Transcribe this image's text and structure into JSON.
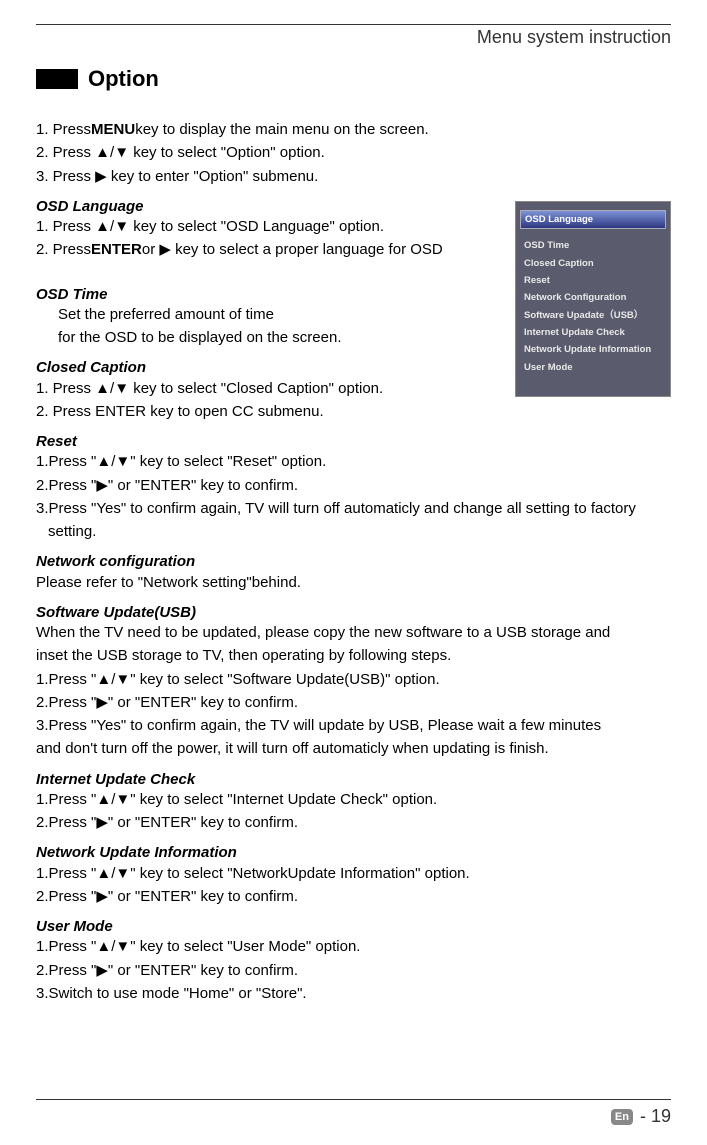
{
  "header_section": "Menu system instruction",
  "title": "Option",
  "intro": {
    "l1_a": "1. Press ",
    "l1_b": "MENU",
    "l1_c": " key to display the main menu on the screen.",
    "l2": "2. Press ▲/▼ key to select \"Option\" option.",
    "l3": "3. Press ▶ key to enter \"Option\" submenu."
  },
  "osd_language": {
    "h": "OSD Language",
    "l1": "1. Press ▲/▼ key to select \"OSD Language\" option.",
    "l2_a": "2. Press ",
    "l2_b": "ENTER",
    "l2_c": " or ▶ key to select a proper language for OSD"
  },
  "osd_time": {
    "h": "OSD Time",
    "l1": "Set the preferred amount of time",
    "l2": "for the OSD to be displayed on the screen."
  },
  "closed_caption": {
    "h": "Closed Caption",
    "l1": "1. Press ▲/▼ key to select \"Closed Caption\" option.",
    "l2": "2. Press  ENTER  key  to  open  CC  submenu."
  },
  "reset": {
    "h": "Reset",
    "l1": "1.Press \"▲/▼\" key to select \"Reset\" option.",
    "l2": "2.Press \"▶\" or \"ENTER\" key to confirm.",
    "l3": "3.Press \"Yes\" to confirm again, TV will turn off automaticly and change all setting to factory",
    "l3b": "setting."
  },
  "network_config": {
    "h": "Network configuration",
    "l1": "Please refer to \"Network setting\"behind."
  },
  "software_update": {
    "h": "Software Update(USB)",
    "l1": "When the TV need to be updated, please copy the new software to a USB storage and",
    "l2": "inset the USB storage to TV, then operating by following steps.",
    "l3": "1.Press \"▲/▼\" key to select \"Software Update(USB)\" option.",
    "l4": "2.Press \"▶\" or \"ENTER\" key to confirm.",
    "l5": "3.Press \"Yes\" to confirm again, the TV will update by USB, Please wait a few minutes",
    "l6": "and don't turn off the power, it will turn off automaticly when updating is finish."
  },
  "internet_update": {
    "h": "Internet Update Check",
    "l1": "1.Press \"▲/▼\" key to select \"Internet Update Check\" option.",
    "l2": "2.Press \"▶\" or \"ENTER\" key to confirm."
  },
  "network_update_info": {
    "h": "Network Update Information",
    "l1": "1.Press \"▲/▼\" key to select \"NetworkUpdate Information\" option.",
    "l2": "2.Press \"▶\" or \"ENTER\" key to confirm."
  },
  "user_mode": {
    "h": "User Mode",
    "l1": "1.Press \"▲/▼\" key to select \"User Mode\" option.",
    "l2": "2.Press \"▶\" or \"ENTER\" key to confirm.",
    "l3": "3.Switch to use mode \"Home\" or \"Store\"."
  },
  "menu_panel": {
    "selected": "OSD Language",
    "items": [
      "OSD Time",
      "Closed Caption",
      "Reset",
      "Network Configuration",
      "Software Upadate（USB）",
      "Internet Update Check",
      "Network Update Information",
      "User Mode"
    ]
  },
  "footer": {
    "badge": "En",
    "page": " - 19"
  }
}
